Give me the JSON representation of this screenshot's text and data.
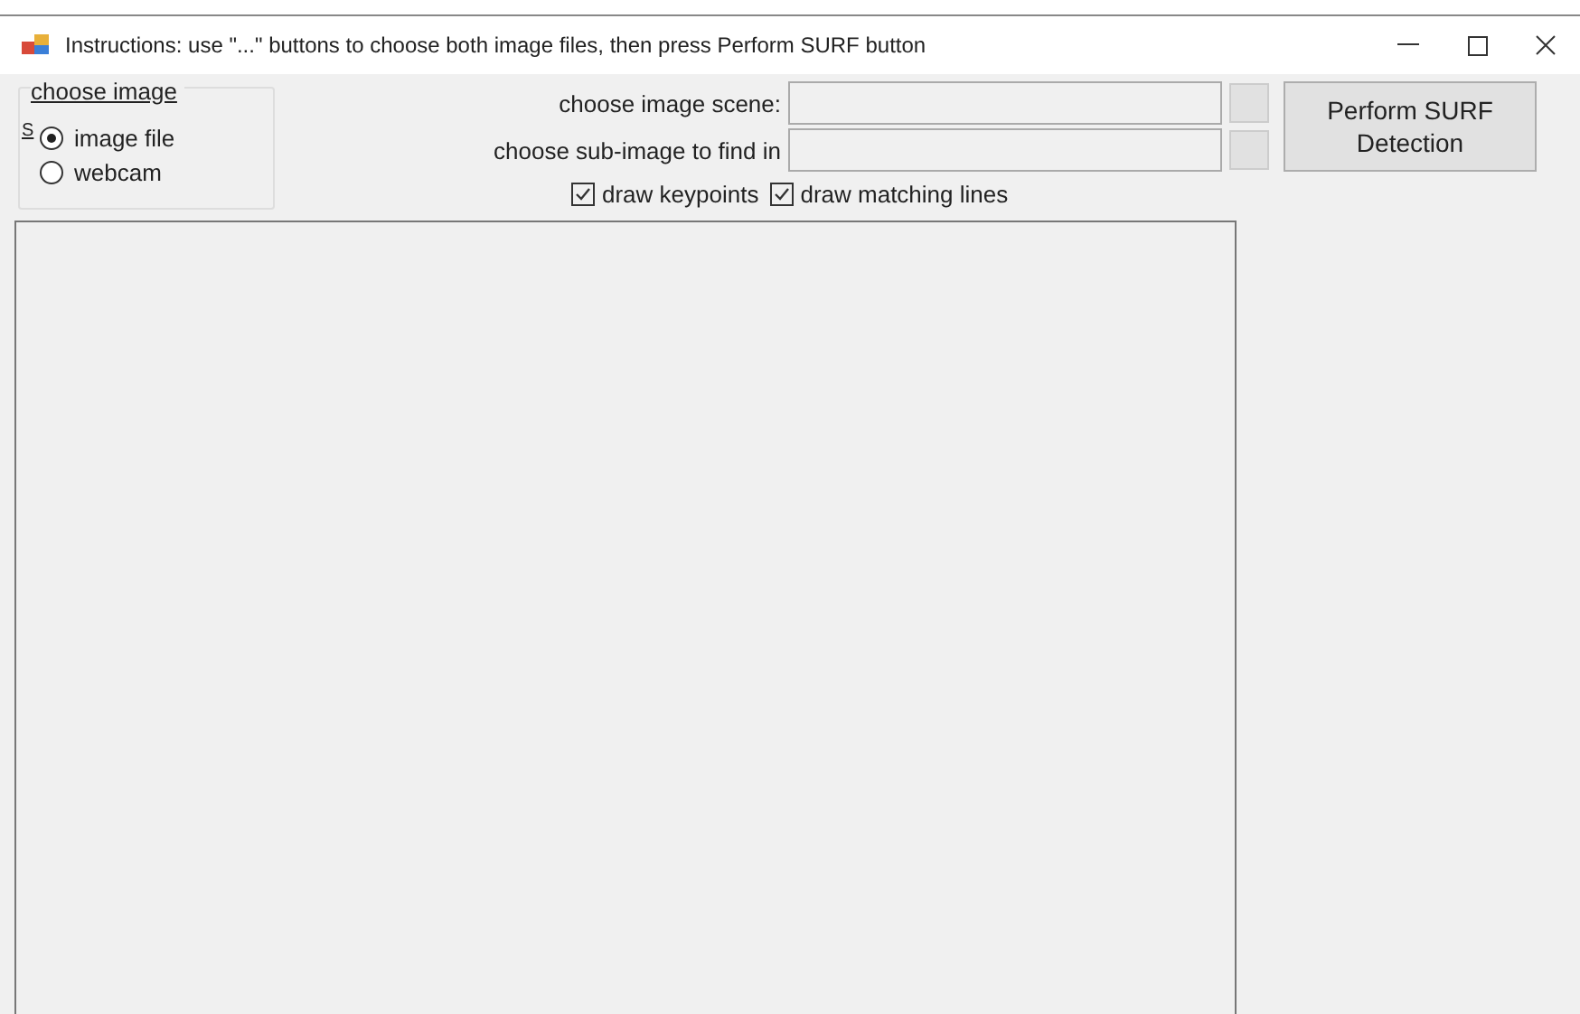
{
  "window": {
    "title": "Instructions: use \"...\" buttons to choose both image files, then press Perform SURF button"
  },
  "source_group": {
    "title": "choose image",
    "label_fragment": "S",
    "options": [
      {
        "label": "image file",
        "selected": true
      },
      {
        "label": "webcam",
        "selected": false
      }
    ]
  },
  "fields": [
    {
      "label": "choose image scene:"
    },
    {
      "label": "choose sub-image to find in"
    }
  ],
  "options": [
    {
      "label": "draw keypoints",
      "checked": true
    },
    {
      "label": "draw matching lines",
      "checked": true
    }
  ],
  "perform_button": {
    "lines": [
      "Perform SURF",
      "Detection"
    ]
  }
}
